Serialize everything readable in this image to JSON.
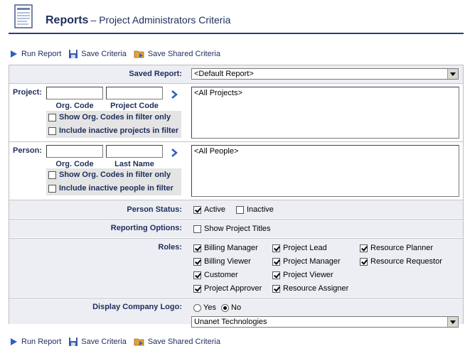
{
  "header": {
    "title": "Reports",
    "subtitle": "– Project Administrators Criteria",
    "icon": "report-document-icon"
  },
  "toolbar": {
    "run": "Run Report",
    "save": "Save Criteria",
    "save_shared": "Save Shared Criteria"
  },
  "saved_report": {
    "label": "Saved Report:",
    "value": "<Default Report>"
  },
  "project": {
    "label": "Project:",
    "org_code_label": "Org. Code",
    "code_label": "Project Code",
    "org_code_value": "",
    "code_value": "",
    "show_org_codes": "Show Org. Codes in filter only",
    "include_inactive": "Include inactive projects in filter",
    "list_item": "<All Projects>"
  },
  "person": {
    "label": "Person:",
    "org_code_label": "Org. Code",
    "last_name_label": "Last Name",
    "org_code_value": "",
    "last_name_value": "",
    "show_org_codes": "Show Org. Codes in filter only",
    "include_inactive": "Include inactive people in filter",
    "list_item": "<All People>"
  },
  "person_status": {
    "label": "Person Status:",
    "active": "Active",
    "inactive": "Inactive"
  },
  "reporting_options": {
    "label": "Reporting Options:",
    "show_titles": "Show Project Titles"
  },
  "roles": {
    "label": "Roles:",
    "billing_manager": "Billing Manager",
    "billing_viewer": "Billing Viewer",
    "customer": "Customer",
    "project_approver": "Project Approver",
    "project_lead": "Project Lead",
    "project_manager": "Project Manager",
    "project_viewer": "Project Viewer",
    "resource_assigner": "Resource Assigner",
    "resource_planner": "Resource Planner",
    "resource_requestor": "Resource Requestor"
  },
  "company_logo": {
    "label": "Display Company Logo:",
    "yes": "Yes",
    "no": "No",
    "selected": "No",
    "logo_value": "Unanet Technologies"
  },
  "colors": {
    "accent": "#1d2e5a",
    "band": "#eceef4"
  }
}
